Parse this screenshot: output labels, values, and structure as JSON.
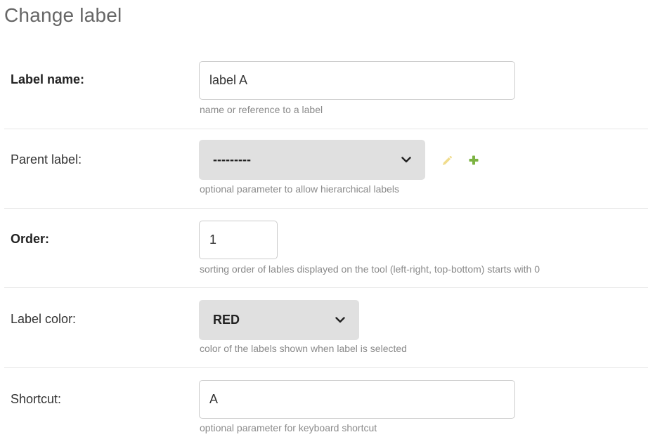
{
  "page": {
    "title": "Change label"
  },
  "fields": {
    "label_name": {
      "label": "Label name:",
      "value": "label A",
      "help": "name or reference to a label"
    },
    "parent_label": {
      "label": "Parent label:",
      "selected": "---------",
      "help": "optional parameter to allow hierarchical labels",
      "edit_icon": "pencil-icon",
      "add_icon": "plus-icon"
    },
    "order": {
      "label": "Order:",
      "value": "1",
      "help": "sorting order of lables displayed on the tool (left-right, top-bottom) starts with 0"
    },
    "label_color": {
      "label": "Label color:",
      "selected": "RED",
      "help": "color of the labels shown when label is selected"
    },
    "shortcut": {
      "label": "Shortcut:",
      "value": "A",
      "help": "optional parameter for keyboard shortcut"
    }
  },
  "colors": {
    "pencil": "#f0dc8c",
    "plus": "#7cb342",
    "select_bg": "#e0e0e0",
    "help_text": "#8a8a8a"
  }
}
